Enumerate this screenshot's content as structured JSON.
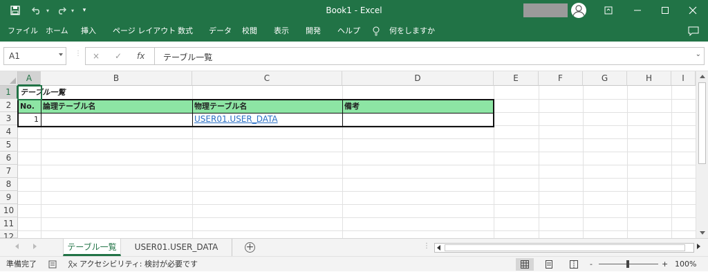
{
  "window": {
    "title": "Book1  -  Excel",
    "quick_access": {
      "save": "save-icon",
      "undo": "undo-icon",
      "redo": "redo-icon",
      "customize": "customize-icon"
    }
  },
  "menu": {
    "items": [
      "ファイル",
      "ホーム",
      "挿入",
      "ページ レイアウト",
      "数式",
      "データ",
      "校閲",
      "表示",
      "開発",
      "ヘルプ"
    ],
    "tell_me": "何をしますか"
  },
  "formula_bar": {
    "name_box": "A1",
    "cancel": "×",
    "enter": "✓",
    "fx": "fx",
    "formula": "テーブル一覧"
  },
  "columns": [
    "A",
    "B",
    "C",
    "D",
    "E",
    "F",
    "G",
    "H",
    "I"
  ],
  "rows": [
    "1",
    "2",
    "3",
    "4",
    "5",
    "6",
    "7",
    "8",
    "9",
    "10",
    "11",
    "12"
  ],
  "cells": {
    "a1": "テーブル一覧",
    "header": {
      "no": "No.",
      "logical": "論理テーブル名",
      "physical": "物理テーブル名",
      "remarks": "備考"
    },
    "row3": {
      "no": "1",
      "logical": "",
      "physical": "USER01.USER_DATA",
      "remarks": ""
    }
  },
  "sheet_tabs": [
    "テーブル一覧",
    "USER01.USER_DATA"
  ],
  "status": {
    "ready": "準備完了",
    "accessibility": "アクセシビリティ: 検討が必要です",
    "zoom_minus": "-",
    "zoom_plus": "+",
    "zoom": "100%"
  },
  "colors": {
    "accent": "#217346",
    "header_fill": "#8de5a4",
    "link": "#2a6fc4"
  }
}
